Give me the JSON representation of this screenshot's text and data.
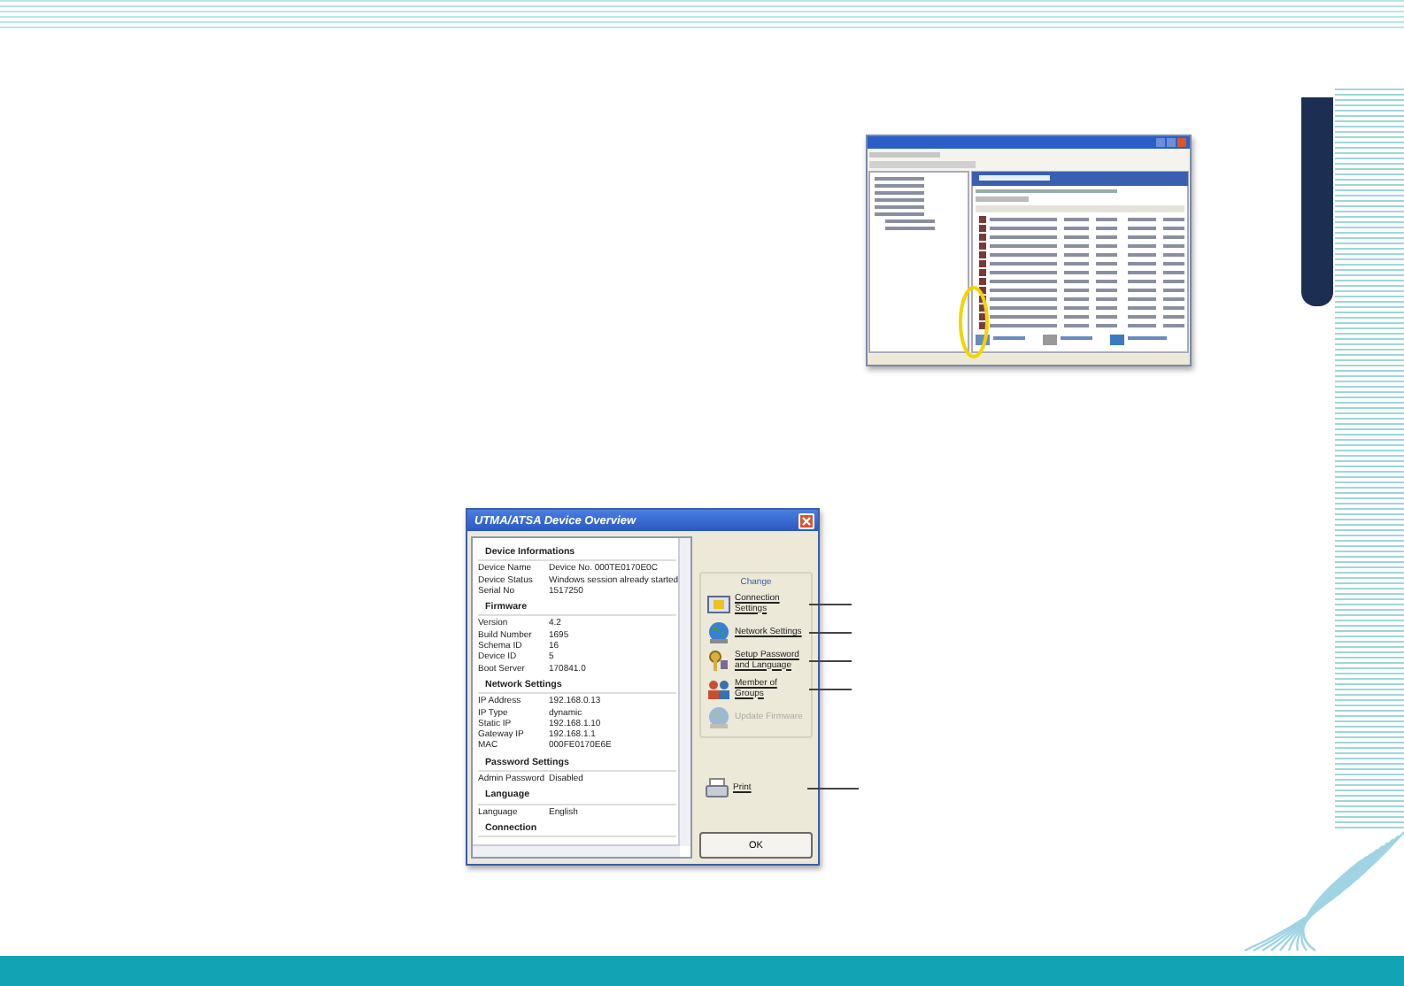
{
  "device_overview": {
    "title": "UTMA/ATSA Device Overview",
    "sections": [
      {
        "title": "Device Informations",
        "rows": [
          {
            "label": "Device Name",
            "value": "Device No. 000TE0170E0C"
          },
          {
            "label": "Device Status",
            "value": "Windows session already started"
          },
          {
            "label": "Serial No",
            "value": "1517250"
          }
        ]
      },
      {
        "title": "Firmware",
        "rows": [
          {
            "label": "Version",
            "value": "4.2"
          },
          {
            "label": "Build Number",
            "value": "1695"
          },
          {
            "label": "Schema ID",
            "value": "16"
          },
          {
            "label": "Device ID",
            "value": "5"
          },
          {
            "label": "Boot Server",
            "value": "170841.0"
          }
        ]
      },
      {
        "title": "Network Settings",
        "rows": [
          {
            "label": "IP Address",
            "value": "192.168.0.13"
          },
          {
            "label": "IP Type",
            "value": "dynamic"
          },
          {
            "label": "Static IP",
            "value": "192.168.1.10"
          },
          {
            "label": "Gateway IP",
            "value": "192.168.1.1"
          },
          {
            "label": "MAC",
            "value": "000FE0170E6E"
          }
        ]
      },
      {
        "title": "Password Settings",
        "rows": [
          {
            "label": "Admin Password",
            "value": "Disabled"
          }
        ]
      },
      {
        "title": "Language",
        "rows": [
          {
            "label": "Language",
            "value": "English"
          }
        ]
      },
      {
        "title": "Connection"
      }
    ],
    "change_group": {
      "title": "Change",
      "actions": [
        {
          "label": "Connection Settings",
          "disabled": false,
          "callout": true
        },
        {
          "label": "Network Settings",
          "disabled": false,
          "callout": true
        },
        {
          "label": "Setup Password and Language",
          "disabled": false,
          "callout": true
        },
        {
          "label": "Member of Groups",
          "disabled": false,
          "callout": true
        },
        {
          "label": "Update Firmware",
          "disabled": true,
          "callout": false
        }
      ]
    },
    "print": {
      "label": "Print",
      "callout": true
    },
    "ok_button": "OK"
  }
}
